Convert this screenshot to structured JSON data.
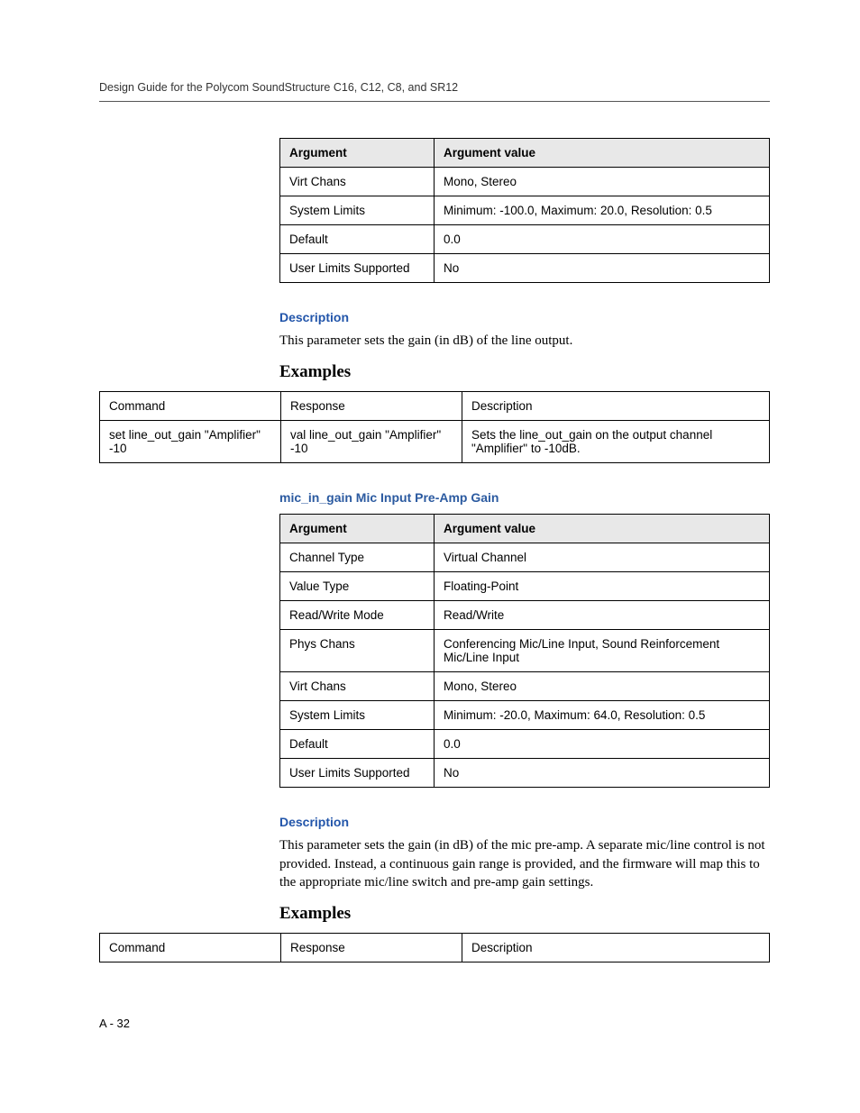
{
  "header": {
    "running_head": "Design Guide for the Polycom SoundStructure C16, C12, C8, and SR12"
  },
  "section1": {
    "table": {
      "head_arg": "Argument",
      "head_val": "Argument value",
      "rows": [
        {
          "arg": "Virt Chans",
          "val": "Mono, Stereo"
        },
        {
          "arg": "System Limits",
          "val": "Minimum: -100.0, Maximum: 20.0, Resolution: 0.5"
        },
        {
          "arg": "Default",
          "val": "0.0"
        },
        {
          "arg": "User Limits Supported",
          "val": "No"
        }
      ]
    },
    "desc_heading": "Description",
    "desc_text": "This parameter sets the gain (in dB) of the line output.",
    "examples_heading": "Examples",
    "examples_table": {
      "head_cmd": "Command",
      "head_resp": "Response",
      "head_desc": "Description",
      "row": {
        "cmd": "set line_out_gain \"Amplifier\" -10",
        "resp": "val line_out_gain \"Amplifier\" -10",
        "desc": "Sets the line_out_gain on the output channel \"Amplifier\" to -10dB."
      }
    }
  },
  "section2": {
    "title": "mic_in_gain Mic Input Pre-Amp Gain",
    "table": {
      "head_arg": "Argument",
      "head_val": "Argument value",
      "rows": [
        {
          "arg": "Channel Type",
          "val": "Virtual Channel"
        },
        {
          "arg": "Value Type",
          "val": "Floating-Point"
        },
        {
          "arg": "Read/Write Mode",
          "val": "Read/Write"
        },
        {
          "arg": "Phys Chans",
          "val": "Conferencing Mic/Line Input, Sound Reinforcement Mic/Line Input"
        },
        {
          "arg": "Virt Chans",
          "val": "Mono, Stereo"
        },
        {
          "arg": "System Limits",
          "val": "Minimum: -20.0, Maximum: 64.0, Resolution: 0.5"
        },
        {
          "arg": "Default",
          "val": "0.0"
        },
        {
          "arg": "User Limits Supported",
          "val": "No"
        }
      ]
    },
    "desc_heading": "Description",
    "desc_text": "This parameter sets the gain (in dB) of the mic pre-amp. A separate mic/line control is not provided. Instead, a continuous gain range is provided, and the firmware will map this to the appropriate mic/line switch and pre-amp gain settings.",
    "examples_heading": "Examples",
    "examples_table": {
      "head_cmd": "Command",
      "head_resp": "Response",
      "head_desc": "Description"
    }
  },
  "footer": {
    "page_label": "A - 32"
  }
}
